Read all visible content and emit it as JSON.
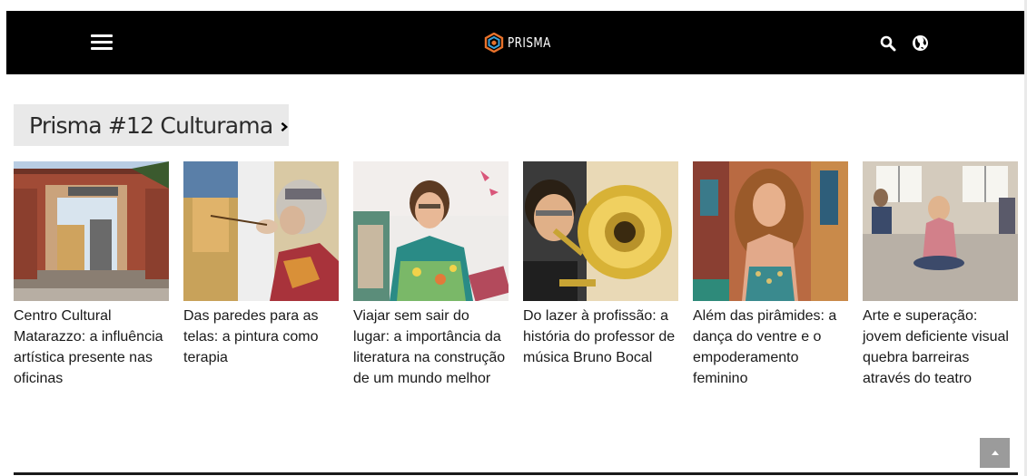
{
  "header": {
    "brand_name": "PRISMA",
    "menu_icon": "hamburger-menu-icon",
    "search_icon": "search-icon",
    "language_icon": "globe-language-icon",
    "background_color": "#000000"
  },
  "section": {
    "title": "Prisma #12 Culturama",
    "chevron_icon": "chevron-right-icon",
    "background_color": "#e9e9e9"
  },
  "articles": [
    {
      "caption": "Centro Cultural Matarazzo: a influência artística presente nas oficinas",
      "image": "brick-arch-gate-photo"
    },
    {
      "caption": "Das paredes para as telas: a pintura como terapia",
      "image": "woman-painting-photo"
    },
    {
      "caption": "Viajar sem sair do lugar: a importância da literatura na construção de um mundo melhor",
      "image": "smiling-woman-books-photo"
    },
    {
      "caption": "Do lazer à profissão: a história do professor de música Bruno Bocal",
      "image": "trombone-player-photo"
    },
    {
      "caption": "Além das pirâmides: a dança do ventre e o empoderamento feminino",
      "image": "belly-dancer-photo"
    },
    {
      "caption": "Arte e superação: jovem deficiente visual quebra barreiras através do teatro",
      "image": "theatre-room-photo"
    }
  ],
  "back_to_top": {
    "icon": "chevron-up-icon",
    "color": "#9b9b9b"
  }
}
